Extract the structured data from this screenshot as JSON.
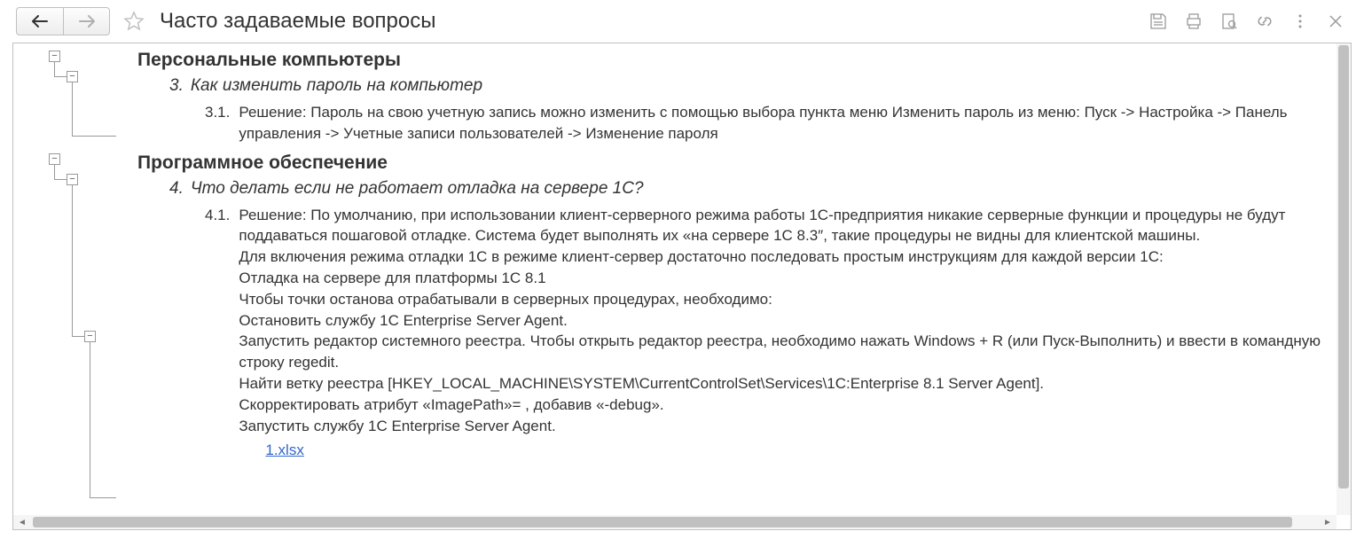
{
  "header": {
    "title": "Часто задаваемые вопросы"
  },
  "sections": [
    {
      "heading": "Персональные компьютеры",
      "q_num": "3.",
      "q_text": "Как изменить пароль на компьютер",
      "a_num": "3.1.",
      "a_text": "Решение: Пароль на свою учетную запись можно изменить с помощью выбора пункта меню Изменить пароль из меню: Пуск -> Настройка -> Панель управления -> Учетные записи пользователей -> Изменение пароля"
    },
    {
      "heading": "Программное обеспечение",
      "q_num": "4.",
      "q_text": "Что делать если не работает отладка на сервере 1С?",
      "a_num": "4.1.",
      "a_lines": [
        "Решение: По умолчанию, при использовании клиент-серверного режима работы 1С-предприятия никакие серверные функции и процедуры не будут поддаваться пошаговой отладке. Система будет выполнять их «на сервере 1С 8.3″, такие процедуры не видны для клиентской машины.",
        "Для включения режима отладки 1С в режиме клиент-сервер достаточно последовать простым инструкциям для каждой версии 1С:",
        "Отладка на сервере для платформы 1С 8.1",
        "Чтобы точки останова отрабатывали в серверных процедурах, необходимо:",
        "Остановить службу 1С Enterprise Server Agent.",
        "Запустить редактор системного реестра. Чтобы открыть редактор реестра, необходимо нажать Windows + R (или Пуск-Выполнить) и ввести в командную строку regedit.",
        "Найти ветку реестра [HKEY_LOCAL_MACHINE\\SYSTEM\\CurrentControlSet\\Services\\1C:Enterprise 8.1 Server Agent].",
        "Скорректировать атрибут «ImagePath»= , добавив «-debug».",
        "Запустить службу 1С Enterprise Server Agent."
      ],
      "attachment": "1.xlsx"
    }
  ]
}
